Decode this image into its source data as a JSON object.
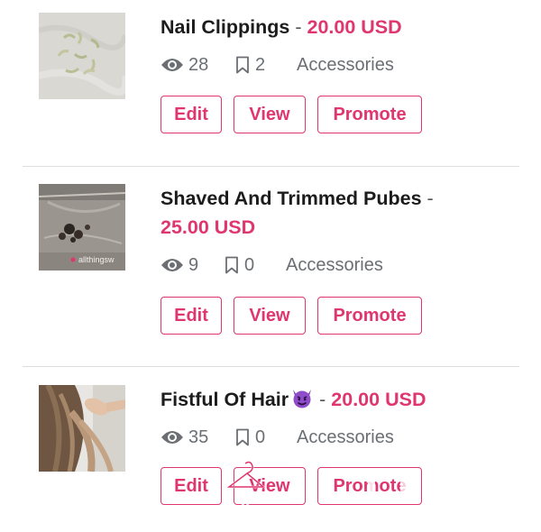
{
  "listings": [
    {
      "title": "Nail Clippings",
      "separator": "-",
      "price": "20.00 USD",
      "views": "28",
      "bookmarks": "2",
      "category": "Accessories"
    },
    {
      "title": "Shaved And Trimmed Pubes",
      "separator": "-",
      "price": "25.00 USD",
      "views": "9",
      "bookmarks": "0",
      "category": "Accessories"
    },
    {
      "title": "Fistful Of Hair",
      "emoji": "smiling-devil-emoji",
      "separator": "-",
      "price": "20.00 USD",
      "views": "35",
      "bookmarks": "0",
      "category": "Accessories"
    }
  ],
  "actions": {
    "edit_label": "Edit",
    "view_label": "View",
    "promote_label": "Promote"
  },
  "colors": {
    "accent": "#e0366f",
    "title": "#1c1c1c",
    "meta": "#6b6f73",
    "divider": "#dedede"
  }
}
